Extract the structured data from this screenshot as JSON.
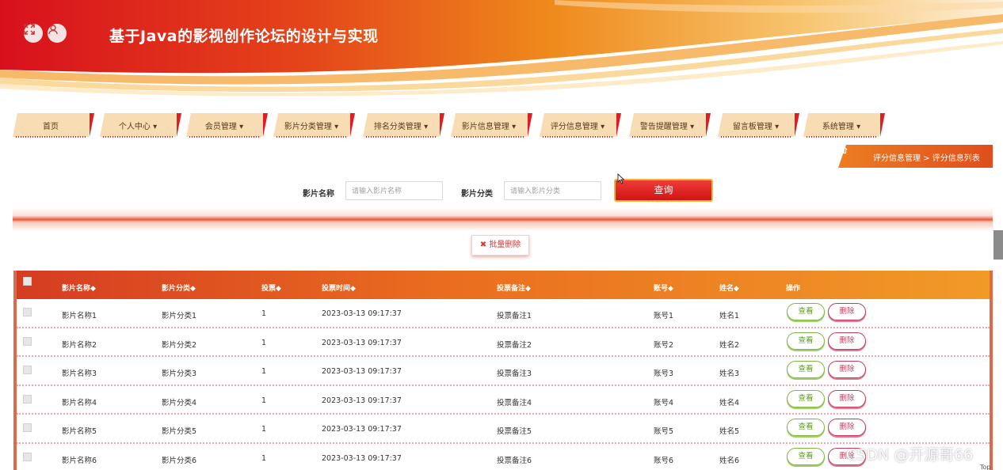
{
  "header": {
    "title": "基于Java的影视创作论坛的设计与实现",
    "fullscreen_icon": "fullscreen-icon",
    "user_icon": "user-icon"
  },
  "nav": {
    "items": [
      {
        "label": "首页"
      },
      {
        "label": "个人中心 ▾"
      },
      {
        "label": "会员管理 ▾"
      },
      {
        "label": "影片分类管理 ▾"
      },
      {
        "label": "排名分类管理 ▾"
      },
      {
        "label": "影片信息管理 ▾"
      },
      {
        "label": "评分信息管理 ▾"
      },
      {
        "label": "警告提醒管理 ▾"
      },
      {
        "label": "留言板管理 ▾"
      },
      {
        "label": "系统管理 ▾"
      }
    ]
  },
  "breadcrumb": {
    "text": "评分信息管理 > 评分信息列表",
    "icon": "home-icon"
  },
  "search": {
    "name_label": "影片名称",
    "name_placeholder": "请输入影片名称",
    "category_label": "影片分类",
    "category_placeholder": "请输入影片分类",
    "query_label": "查询"
  },
  "batch_delete": {
    "label": "批量删除",
    "icon": "close-icon"
  },
  "table": {
    "columns": [
      "影片名称◆",
      "影片分类◆",
      "投票◆",
      "投票时间◆",
      "投票备注◆",
      "账号◆",
      "姓名◆",
      "操作"
    ],
    "view_label": "查看",
    "delete_label": "删除",
    "rows": [
      [
        "影片名称1",
        "影片分类1",
        "1",
        "2023-03-13 09:17:37",
        "投票备注1",
        "账号1",
        "姓名1"
      ],
      [
        "影片名称2",
        "影片分类2",
        "1",
        "2023-03-13 09:17:37",
        "投票备注2",
        "账号2",
        "姓名2"
      ],
      [
        "影片名称3",
        "影片分类3",
        "1",
        "2023-03-13 09:17:37",
        "投票备注3",
        "账号3",
        "姓名3"
      ],
      [
        "影片名称4",
        "影片分类4",
        "1",
        "2023-03-13 09:17:37",
        "投票备注4",
        "账号4",
        "姓名4"
      ],
      [
        "影片名称5",
        "影片分类5",
        "1",
        "2023-03-13 09:17:37",
        "投票备注5",
        "账号5",
        "姓名5"
      ],
      [
        "影片名称6",
        "影片分类6",
        "1",
        "2023-03-13 09:17:37",
        "投票备注6",
        "账号6",
        "姓名6"
      ]
    ]
  },
  "watermark": "CSDN @开源哥66",
  "scroll_top": "Top",
  "colors": {
    "primary_red": "#d9161c",
    "orange": "#ee7f22",
    "nav_bg": "#f7dcb4",
    "view_green": "#7fb541",
    "delete_red": "#c53b5c"
  }
}
